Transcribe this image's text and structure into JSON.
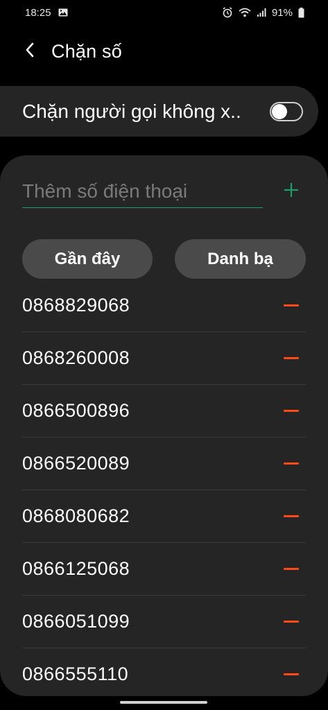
{
  "status_bar": {
    "time": "18:25",
    "battery": "91%",
    "icons": [
      "image-icon",
      "alarm-icon",
      "wifi-icon",
      "signal-icon",
      "battery-icon"
    ]
  },
  "header": {
    "title": "Chặn số",
    "back_icon": "back-arrow-icon"
  },
  "toggle": {
    "label": "Chặn người gọi không x..",
    "state": "off"
  },
  "add_number": {
    "placeholder": "Thêm số điện thoại",
    "add_icon": "plus-icon",
    "accent_color": "#1f9e6a"
  },
  "buttons": {
    "recent": "Gần đây",
    "contacts": "Danh bạ"
  },
  "blocked_numbers": [
    "0868829068",
    "0868260008",
    "0866500896",
    "0866520089",
    "0868080682",
    "0866125068",
    "0866051099",
    "0866555110"
  ],
  "remove_color": "#ff4a17"
}
